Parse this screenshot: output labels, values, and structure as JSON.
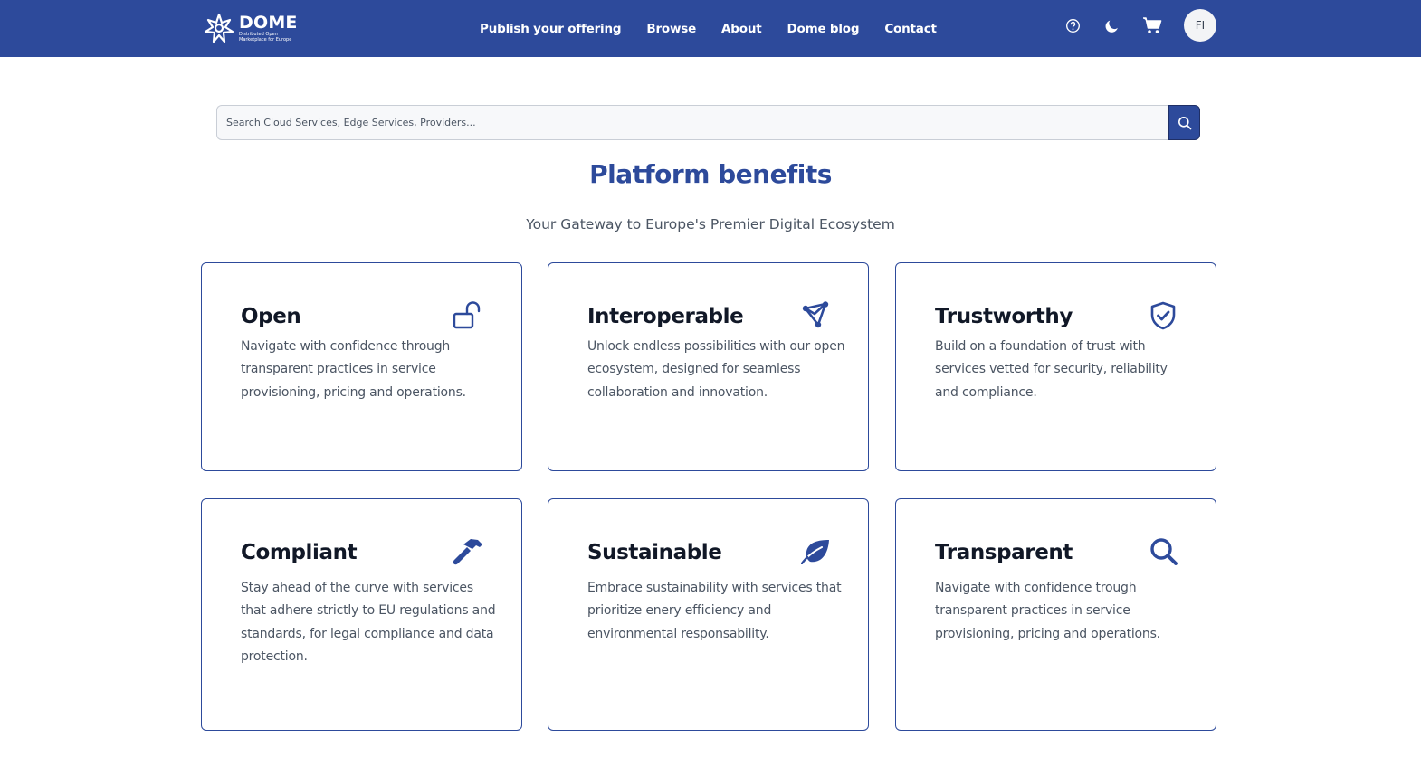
{
  "header": {
    "logo_title": "DOME",
    "logo_subtitle": "Distributed Open Marketplace for Europe",
    "nav": [
      "Publish your offering",
      "Browse",
      "About",
      "Dome blog",
      "Contact"
    ],
    "avatar_initials": "FI"
  },
  "search": {
    "placeholder": "Search Cloud Services, Edge Services, Providers..."
  },
  "section": {
    "title": "Platform benefits",
    "subtitle": "Your Gateway to Europe's Premier Digital Ecosystem"
  },
  "cards": [
    {
      "title": "Open",
      "text": "Navigate with confidence through transparent practices in service provisioning, pricing and operations.",
      "icon": "unlock-icon"
    },
    {
      "title": "Interoperable",
      "text": "Unlock endless possibilities with our open ecosystem, designed for seamless collaboration and innovation.",
      "icon": "network-icon"
    },
    {
      "title": "Trustworthy",
      "text": "Build on a foundation of trust with services vetted for security, reliability and compliance.",
      "icon": "shield-check-icon"
    },
    {
      "title": "Compliant",
      "text": "Stay ahead of the curve with services that adhere strictly to EU regulations and standards, for legal compliance and data protection.",
      "icon": "hammer-icon"
    },
    {
      "title": "Sustainable",
      "text": "Embrace sustainability with services that prioritize enery efficiency and environmental responsability.",
      "icon": "leaf-icon"
    },
    {
      "title": "Transparent",
      "text": "Navigate with confidence trough transparent practices in service provisioning, pricing and operations.",
      "icon": "magnifier-icon"
    }
  ],
  "colors": {
    "brand": "#2d4a9b",
    "text": "#111827",
    "muted": "#4b5563"
  }
}
